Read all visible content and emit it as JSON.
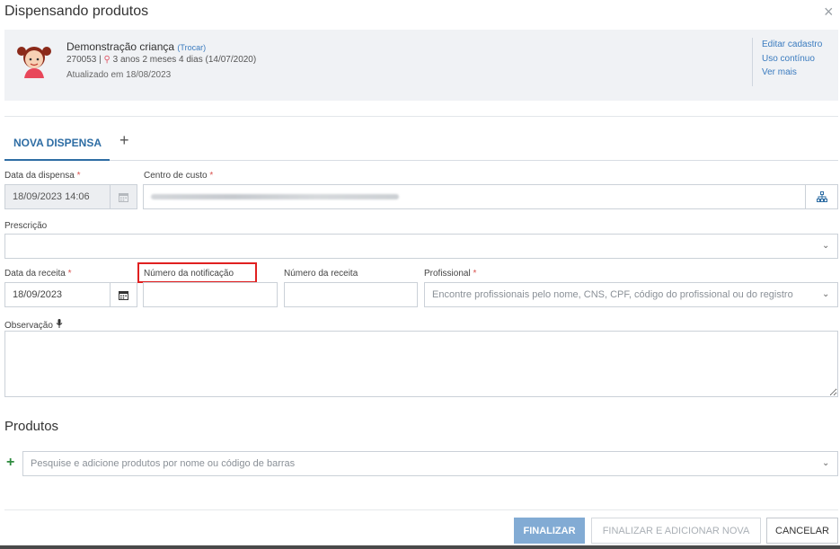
{
  "modal": {
    "title": "Dispensando produtos",
    "close_icon": "×"
  },
  "patient": {
    "name": "Demonstração criança",
    "change_link": "(Trocar)",
    "id": "270053",
    "separator": "|",
    "age": "3 anos 2 meses 4 dias (14/07/2020)",
    "updated": "Atualizado em 18/08/2023",
    "links": [
      "Editar cadastro",
      "Uso contínuo",
      "Ver mais"
    ]
  },
  "tabs": {
    "active": "NOVA DISPENSA",
    "add": "+"
  },
  "form": {
    "data_dispensa": {
      "label": "Data da dispensa",
      "value": "18/09/2023 14:06"
    },
    "centro_custo": {
      "label": "Centro de custo"
    },
    "prescricao": {
      "label": "Prescrição"
    },
    "data_receita": {
      "label": "Data da receita",
      "value": "18/09/2023"
    },
    "numero_notificacao": {
      "label": "Número da notificação",
      "value": ""
    },
    "numero_receita": {
      "label": "Número da receita",
      "value": ""
    },
    "profissional": {
      "label": "Profissional",
      "placeholder": "Encontre profissionais pelo nome, CNS, CPF, código do profissional ou do registro"
    },
    "observacao": {
      "label": "Observação"
    },
    "required_mark": "*"
  },
  "produtos": {
    "title": "Produtos",
    "add": "+",
    "search_placeholder": "Pesquise e adicione produtos por nome ou código de barras"
  },
  "footer": {
    "finalizar": "FINALIZAR",
    "finalizar_nova": "FINALIZAR E ADICIONAR NOVA",
    "cancelar": "CANCELAR"
  },
  "icons": {
    "calendar": "calendar-icon",
    "hierarchy": "hierarchy-icon",
    "chevron": "chevron-down-icon",
    "mic": "microphone-icon",
    "pin": "location-pin-icon"
  },
  "colors": {
    "accent": "#2e6da4",
    "link": "#3a7bbf",
    "required": "#d9534f",
    "highlight": "#e02020",
    "add_green": "#2e8b3e",
    "primary_button": "#82abd4"
  }
}
